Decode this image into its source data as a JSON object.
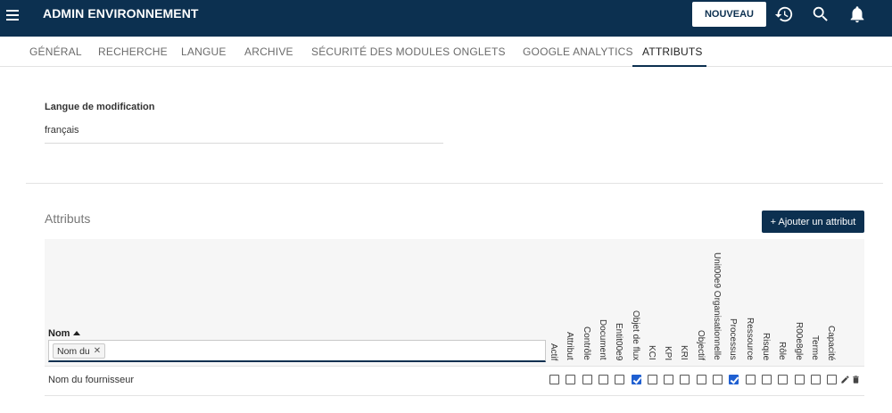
{
  "header": {
    "title": "ADMIN ENVIRONNEMENT",
    "new_button": "NOUVEAU",
    "icons": [
      "menu-icon",
      "history-icon",
      "search-icon",
      "bell-icon"
    ]
  },
  "tabs": [
    {
      "label": "GÉNÉRAL",
      "active": false
    },
    {
      "label": "RECHERCHE",
      "active": false
    },
    {
      "label": "LANGUE",
      "active": false
    },
    {
      "label": "ARCHIVE",
      "active": false
    },
    {
      "label": "SÉCURITÉ DES MODULES",
      "active": false
    },
    {
      "label": "ONGLETS",
      "active": false
    },
    {
      "label": "GOOGLE ANALYTICS",
      "active": false
    },
    {
      "label": "ATTRIBUTS",
      "active": true
    }
  ],
  "language": {
    "label": "Langue de modification",
    "value": "français"
  },
  "attributes": {
    "title": "Attributs",
    "add_button": "+ Ajouter un attribut",
    "name_column": "Nom",
    "filter_chip": "Nom du",
    "columns": [
      "Actif",
      "Attribut",
      "Contrôle",
      "Document",
      "Entit00e9",
      "Objet de flux",
      "KCI",
      "KPI",
      "KRI",
      "Objectif",
      "Unit00e9 Organisationnelle",
      "Processus",
      "Ressource",
      "Risque",
      "Rôle",
      "R00e8gle",
      "Terme",
      "Capacité"
    ],
    "rows": [
      {
        "name": "Nom du fournisseur",
        "checked": [
          false,
          false,
          false,
          false,
          false,
          true,
          false,
          false,
          false,
          false,
          false,
          true,
          false,
          false,
          false,
          false,
          false,
          false
        ],
        "actions": [
          "edit-icon",
          "delete-icon"
        ]
      }
    ]
  },
  "colors": {
    "topbar": "#0c3050",
    "accent": "#1f5fd1"
  }
}
